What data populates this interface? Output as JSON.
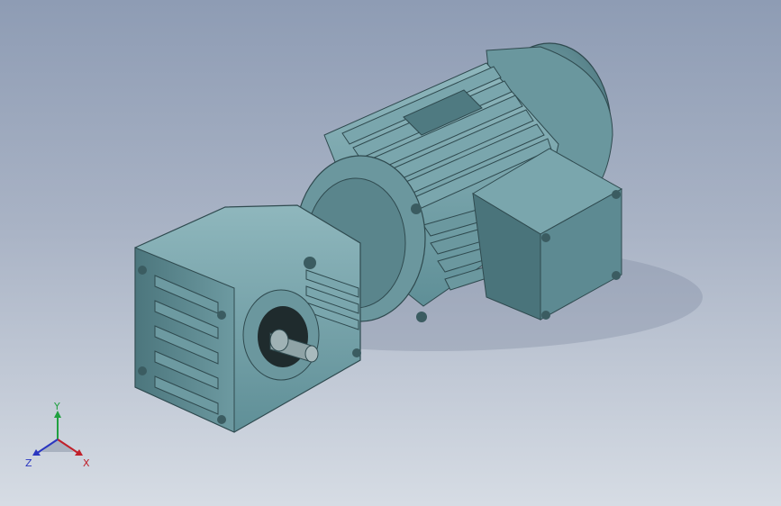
{
  "viewport": {
    "background_top": "#8e9cb4",
    "background_bottom": "#d6dce4",
    "model_color": "#5f8f97",
    "model_shadow": "#3d6066"
  },
  "model": {
    "name_icon": "gear-motor-3d-model",
    "parts": [
      "motor-fan-cover",
      "motor-cooling-fins",
      "terminal-box",
      "motor-flange",
      "helical-bevel-gearbox",
      "output-shaft",
      "mounting-bolt"
    ]
  },
  "triad": {
    "x_label": "X",
    "y_label": "Y",
    "z_label": "Z",
    "x_color": "#c0202a",
    "y_color": "#20a040",
    "z_color": "#2a36c0"
  }
}
